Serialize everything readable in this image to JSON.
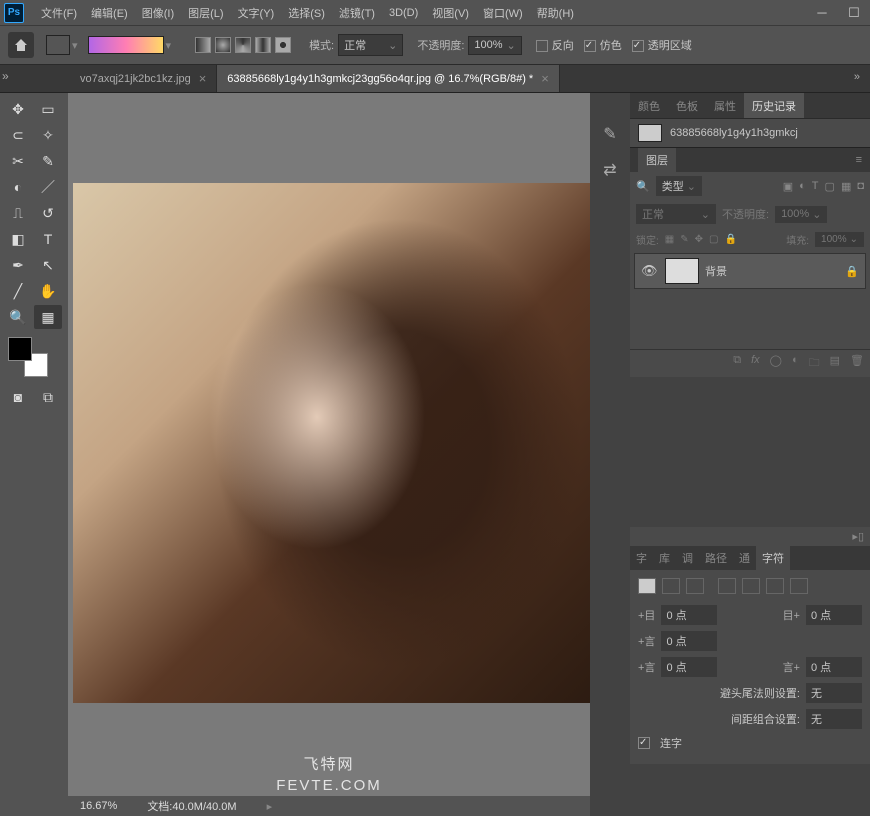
{
  "app": {
    "logo": "Ps"
  },
  "menu": [
    "文件(F)",
    "编辑(E)",
    "图像(I)",
    "图层(L)",
    "文字(Y)",
    "选择(S)",
    "滤镜(T)",
    "3D(D)",
    "视图(V)",
    "窗口(W)",
    "帮助(H)"
  ],
  "options": {
    "mode_label": "模式:",
    "mode_value": "正常",
    "opacity_label": "不透明度:",
    "opacity_value": "100%",
    "reverse": "反向",
    "dither": "仿色",
    "transparency": "透明区域"
  },
  "tabs": [
    {
      "title": "vo7axqj21jk2bc1kz.jpg",
      "active": false
    },
    {
      "title": "63885668ly1g4y1h3gmkcj23gg56o4qr.jpg @ 16.7%(RGB/8#) *",
      "active": true
    }
  ],
  "status": {
    "zoom": "16.67%",
    "docinfo": "文档:40.0M/40.0M"
  },
  "right_tabs": [
    "颜色",
    "色板",
    "属性",
    "历史记录"
  ],
  "history_item": "63885668ly1g4y1h3gmkcj",
  "layers": {
    "panel_title": "图层",
    "filter": "类型",
    "blend": "正常",
    "opacity_label": "不透明度:",
    "opacity_value": "100%",
    "lock_label": "锁定:",
    "fill_label": "填充:",
    "fill_value": "100%",
    "layer_name": "背景"
  },
  "paragraph": {
    "tabs": [
      "字",
      "库",
      "调",
      "路径",
      "通",
      "字符"
    ],
    "shift_label1": "+目",
    "shift_label2": "目+",
    "indent_pre": "+言",
    "indent_post": "言+",
    "zero": "0 点",
    "kumi_label": "避头尾法则设置:",
    "kumi_value": "无",
    "spacing_label": "间距组合设置:",
    "spacing_value": "无",
    "hyphen": "连字"
  },
  "watermark": {
    "l1": "飞特网",
    "l2": "FEVTE.COM"
  }
}
